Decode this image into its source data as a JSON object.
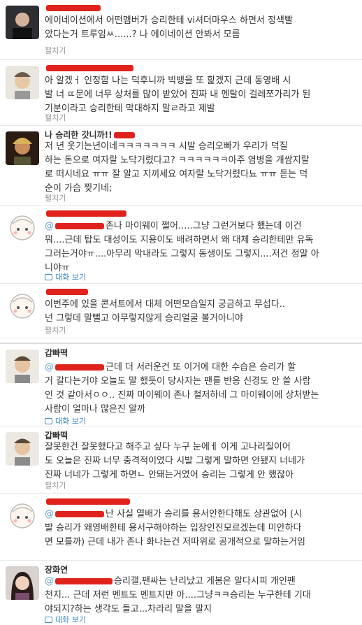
{
  "tweets": [
    {
      "name": "",
      "lines": [
        "에이네이션에서 어떤멤버가 승리한테 vi셔더마우스 하면서 정색빨",
        "았다는거 트루임ㅆ......? 나 에이네이션 안봐서 모름"
      ],
      "action": "펼치기"
    },
    {
      "name": "",
      "lines": [
        "아 알겠ㅓ  인정함 나는 덕후니까 빅뱅을 또 핥겠지 근데 동영배 시",
        "발 너 ㄸ문에 너무 상처를 많이 받았어 진짜 내 멘탈이 걸레쪼가리가 된",
        "기분이라고 승리한테 막대하지 말ㄹ라고 제발"
      ],
      "action": "펼치기"
    },
    {
      "name": "나 승리한 갓니까!!",
      "lines": [
        "저 년 웃기는년이네ㅋㅋㅋㅋㅋㅋㅋ 시발 승리오빠가 우리가 덕질",
        "하는 돈으로 여자랄 노닥거렸다고? ㅋㅋㅋㅋㅋㅋ아주 염병을 개쌈지랄",
        "로 떠시네요 ㅠㅠ 잘 알고 지끼세요 여자랄 노닥거렸다뇨 ㅠㅠ 듣는 덕",
        "순이 가슴 찢기네;"
      ],
      "action": "펼치기"
    },
    {
      "name": "",
      "mention": "@",
      "lines": [
        "존나 마이웨이 쩔어.....그냥 그런거보다 했는데 이건",
        "뭐....근데 탑도 대성이도 지용이도 배려하면서 왜 대체 승리한테만 유독",
        "그러는거야ㅠ....아무리 막내라도 그렇지 동생이도 그렇지....저건 정말 아",
        "니야ㅠ"
      ],
      "action": "대화 보기"
    },
    {
      "name": "",
      "lines": [
        "이번주에 있을 콘서트에서 대체 어떤모습일지 궁금하고 무섭다..",
        "넌 그렇데 말뻘고 아무렇지않게 승리얼굴 볼거아니야"
      ],
      "action": "펼치기"
    },
    {
      "name": "갑빠떡",
      "mention": "@",
      "lines": [
        "근데 더 서러운건 또 이거에 대한 수습은 승리가 할",
        "거 갈다는거야 오늘도 말 했듯이 당사자는 팬를 반응 신경도 안 쓸 사람",
        "인 것 같아서ㅇㅇ.. 진짜 마이웨이 존나 철저하네 그 마이웨이에 상처받는",
        "사람이 얼마나 많은진 알까"
      ],
      "action": "대화 보기"
    },
    {
      "name": "갑빠떡",
      "lines": [
        "잘못한건 잘못했다고 해주고 싶다 누구 눈에ㅔ 이게 고나리질이어",
        "도 오늘은 진짜 너무 충격적이였다 시발 그렇게 말하면 안됐지 너네가",
        "진짜 너네가 그렇게 하면ㄴ 안돼는거였어 승리는 그렇게 안 했잖아"
      ],
      "action": "펼치기"
    },
    {
      "name": "",
      "mention": "@",
      "lines": [
        "난 사실 열배가 승리를 용서안한다해도 상관없어 (시",
        "발 승리가 왜영배한테 용서구해야하는 입장인진모르겠는데 미안하다",
        "면 모를까) 근데 내가 존나 화나는건 저따위로 공개적으로 말하는거임"
      ],
      "action": ""
    },
    {
      "name": "장화연",
      "mention": "@",
      "lines": [
        "승리갤,팬싸는 난리났고 게봄은 알다시피 개인팬",
        "천지... 근데 저런 멘트도 멘트지만 아....그냥ㅋㅋ승리는 누구한테 기대",
        "야되지?하는 생각도 들고...차라리 말을 말지"
      ],
      "action": "대화 보기"
    }
  ]
}
